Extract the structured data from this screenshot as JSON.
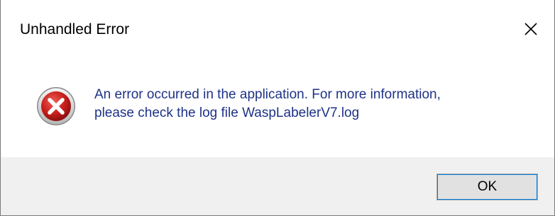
{
  "dialog": {
    "title": "Unhandled Error",
    "close_icon": "close-icon",
    "icon": "error-icon",
    "message_line1": "An error occurred in the application. For more information,",
    "message_line2": "please check the log file WaspLabelerV7.log",
    "ok_label": "OK"
  },
  "colors": {
    "message_text": "#1e3287",
    "footer_background": "#f0f0f0",
    "error_red": "#c8201d",
    "button_focus": "#0078d7"
  }
}
